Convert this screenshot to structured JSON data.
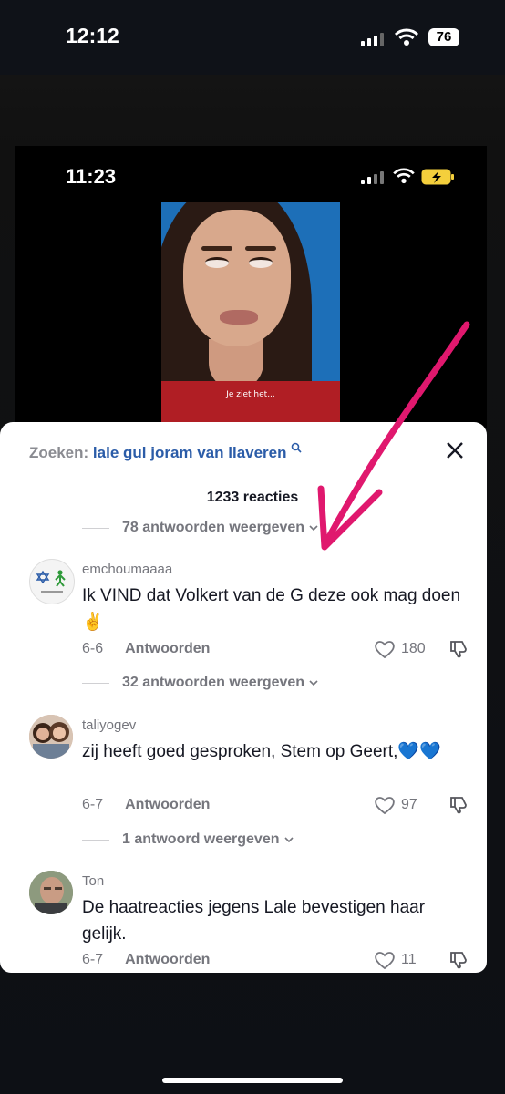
{
  "outer_status": {
    "time": "12:12",
    "battery": "76"
  },
  "inner_status": {
    "time": "11:23"
  },
  "video": {
    "caption": "Je ziet het..."
  },
  "search": {
    "label": "Zoeken:",
    "query": "lale gul joram van llaveren"
  },
  "comments_count": "1233 reacties",
  "thread": [
    {
      "replies_link": "78 antwoorden weergeven"
    },
    {
      "username": "emchoumaaaa",
      "text": "Ik VIND dat Volkert van de G deze ook mag doen ✌️",
      "date": "6-6",
      "reply": "Antwoorden",
      "likes": "180",
      "replies_link": "32 antwoorden weergeven"
    },
    {
      "username": "taliyogev",
      "text": "zij heeft goed gesproken, Stem op Geert,💙💙",
      "date": "6-7",
      "reply": "Antwoorden",
      "likes": "97",
      "replies_link": "1 antwoord weergeven"
    },
    {
      "username": "Ton",
      "text": "De haatreacties jegens Lale bevestigen haar gelijk.",
      "date": "6-7",
      "reply": "Antwoorden",
      "likes": "11"
    }
  ],
  "colors": {
    "arrow": "#e0186e",
    "link_blue": "#2b5ca8",
    "muted": "#75767d"
  },
  "icons": [
    "signal-icon",
    "wifi-icon",
    "battery-icon",
    "search-icon",
    "close-icon",
    "heart-icon",
    "dislike-icon",
    "chevron-down-icon"
  ]
}
